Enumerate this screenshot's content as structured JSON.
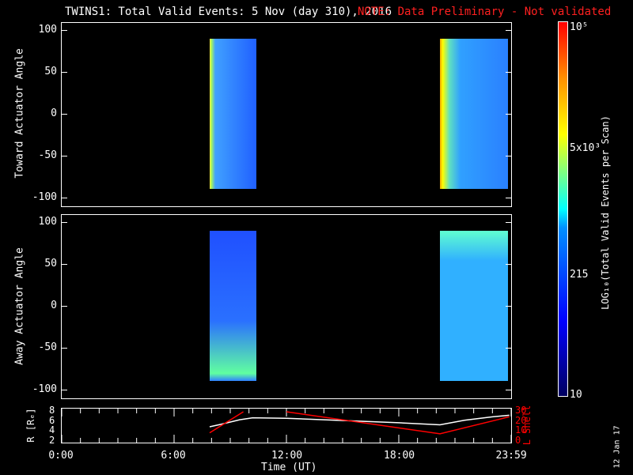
{
  "title": "TWINS1: Total Valid Events:  5 Nov (day 310), 2016",
  "note": "NOTE: Data Preliminary - Not validated",
  "colors": {
    "note": "#ff2020",
    "lshell": "#ff0000"
  },
  "chart_data": [
    {
      "type": "heatmap",
      "name": "toward",
      "ylabel": "Toward Actuator Angle",
      "ylim": [
        -100,
        100
      ],
      "yticks": [
        "100",
        "50",
        "0",
        "-50",
        "-100"
      ],
      "xlim_hours": [
        0,
        24
      ],
      "data_intervals_hours": [
        [
          7.9,
          10.4
        ],
        [
          20.2,
          23.85
        ]
      ]
    },
    {
      "type": "heatmap",
      "name": "away",
      "ylabel": "Away Actuator Angle",
      "ylim": [
        -100,
        100
      ],
      "yticks": [
        "100",
        "50",
        "0",
        "-50",
        "-100"
      ],
      "xlim_hours": [
        0,
        24
      ],
      "data_intervals_hours": [
        [
          7.9,
          10.4
        ],
        [
          20.2,
          23.85
        ]
      ]
    },
    {
      "type": "line",
      "name": "ephemeris",
      "ylabel": "R [Rₑ]",
      "y2label": "L Shell",
      "ylim": [
        2,
        8
      ],
      "y2lim": [
        0,
        30
      ],
      "yticks": [
        "8",
        "6",
        "4",
        "2"
      ],
      "y2ticks": [
        "30",
        "20",
        "10",
        "0"
      ],
      "xlabel": "Time (UT)",
      "xticks": [
        "0:00",
        "6:00",
        "12:00",
        "18:00",
        "23:59"
      ],
      "series": [
        {
          "name": "R",
          "x": [
            7.9,
            8.5,
            9.5,
            10.2,
            12,
            14,
            16,
            18,
            20.2,
            21.5,
            23,
            23.9
          ],
          "y": [
            5.0,
            5.5,
            6.4,
            6.8,
            6.7,
            6.4,
            6.1,
            5.8,
            5.4,
            6.3,
            7.0,
            7.3
          ]
        },
        {
          "name": "L Shell",
          "x": [
            7.9,
            9.7
          ],
          "y": [
            9,
            30
          ]
        },
        {
          "name": "L Shell b",
          "x": [
            12,
            20.2,
            23.9
          ],
          "y": [
            30,
            8,
            25
          ]
        }
      ]
    }
  ],
  "colorbar": {
    "label": "LOG₁₀(Total Valid Events per Scan)",
    "ticks": [
      "10",
      "215",
      "5x10³",
      "10⁵"
    ]
  },
  "datestamp": "12 Jan 17"
}
